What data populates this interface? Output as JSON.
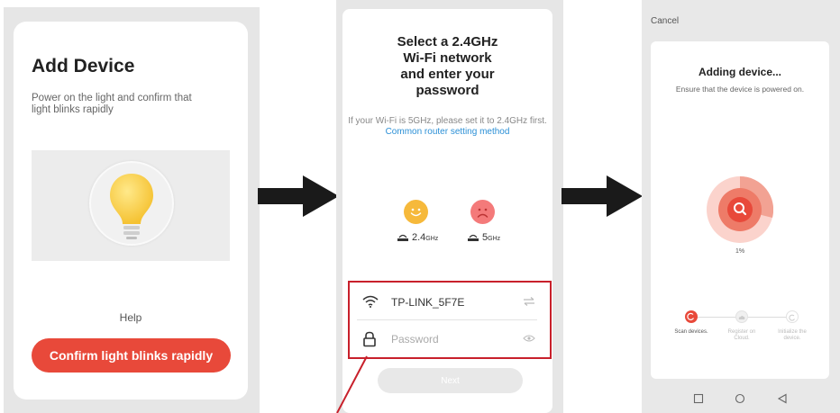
{
  "screen1": {
    "title": "Add Device",
    "description": "Power on the light and confirm that light blinks  rapidly",
    "help": "Help",
    "confirm_button": "Confirm light blinks rapidly"
  },
  "screen2": {
    "title_lines": [
      "Select a 2.4GHz",
      "Wi-Fi network",
      "and enter your",
      "password"
    ],
    "note_prefix": "If your Wi-Fi is 5GHz, please set it to 2.4GHz first.",
    "note_link": "Common router setting method",
    "band_ok": "2.4",
    "band_ok_unit": "GHz",
    "band_bad": "5",
    "band_bad_unit": "GHz",
    "network_name": "TP-LINK_5F7E",
    "password_placeholder": "Password",
    "next_button": "Next"
  },
  "screen3": {
    "cancel": "Cancel",
    "title": "Adding device...",
    "subtitle": "Ensure that the device is powered on.",
    "progress_percent": "1%",
    "steps": [
      {
        "label": "Scan devices.",
        "state": "active"
      },
      {
        "label": "Register on Cloud.",
        "state": "pending"
      },
      {
        "label": "Initialize the device.",
        "state": "pending"
      }
    ]
  },
  "colors": {
    "accent": "#e8493a",
    "link": "#2a8fd6",
    "highlight": "#c8202b"
  }
}
